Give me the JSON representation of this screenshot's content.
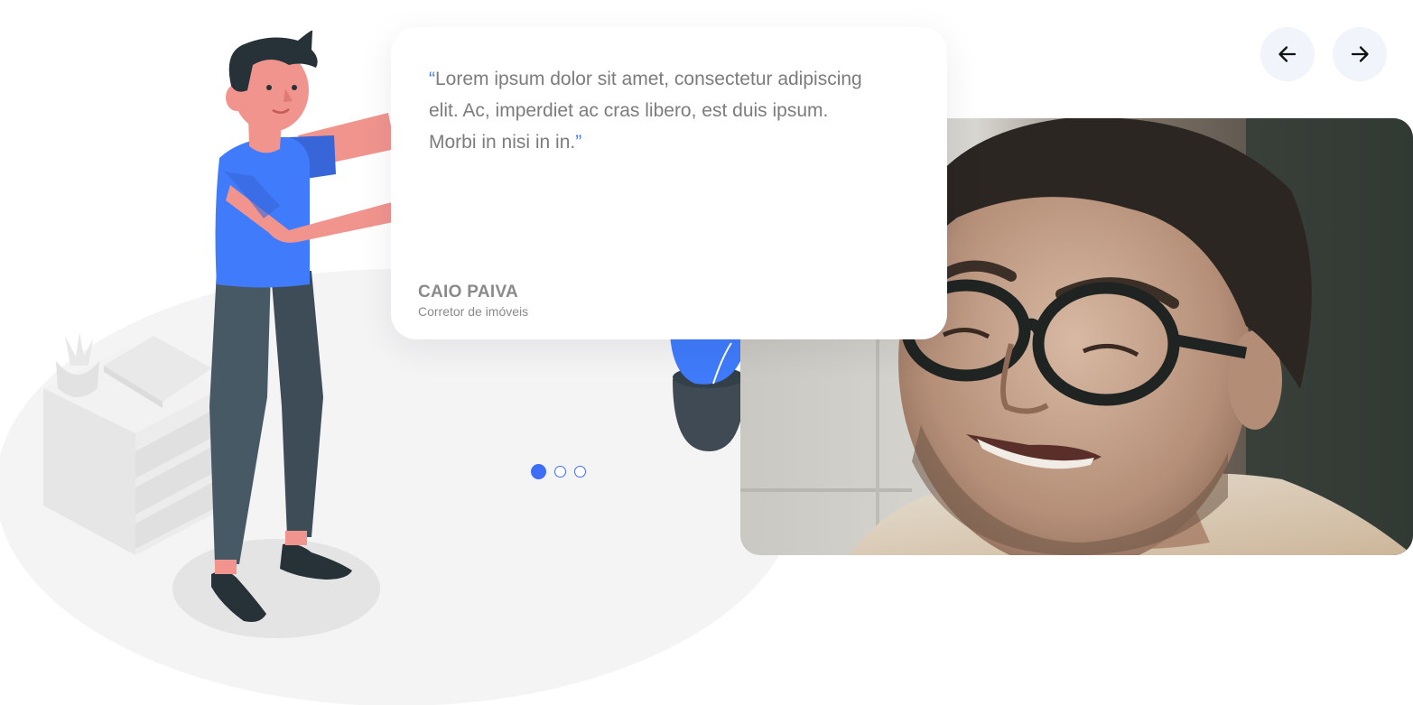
{
  "testimonial": {
    "open_quote": "“",
    "text": "Lorem ipsum dolor sit amet, consectetur adipiscing elit. Ac, imperdiet ac cras libero, est duis ipsum. Morbi in nisi in in.",
    "close_quote": "”",
    "author_name": "CAIO PAIVA",
    "author_role": "Corretor de imóveis"
  },
  "navigation": {
    "prev_icon": "arrow-left-icon",
    "next_icon": "arrow-right-icon"
  },
  "pagination": {
    "total": 3,
    "active_index": 0
  },
  "colors": {
    "accent": "#3d6ef5",
    "shirt": "#3f7bfa",
    "text": "#7c7c7c",
    "nav_bg": "#f1f4fb"
  },
  "illustration": {
    "subject": "person-presenting-illustration"
  },
  "photo": {
    "subject": "smiling-man-with-glasses-photo"
  }
}
